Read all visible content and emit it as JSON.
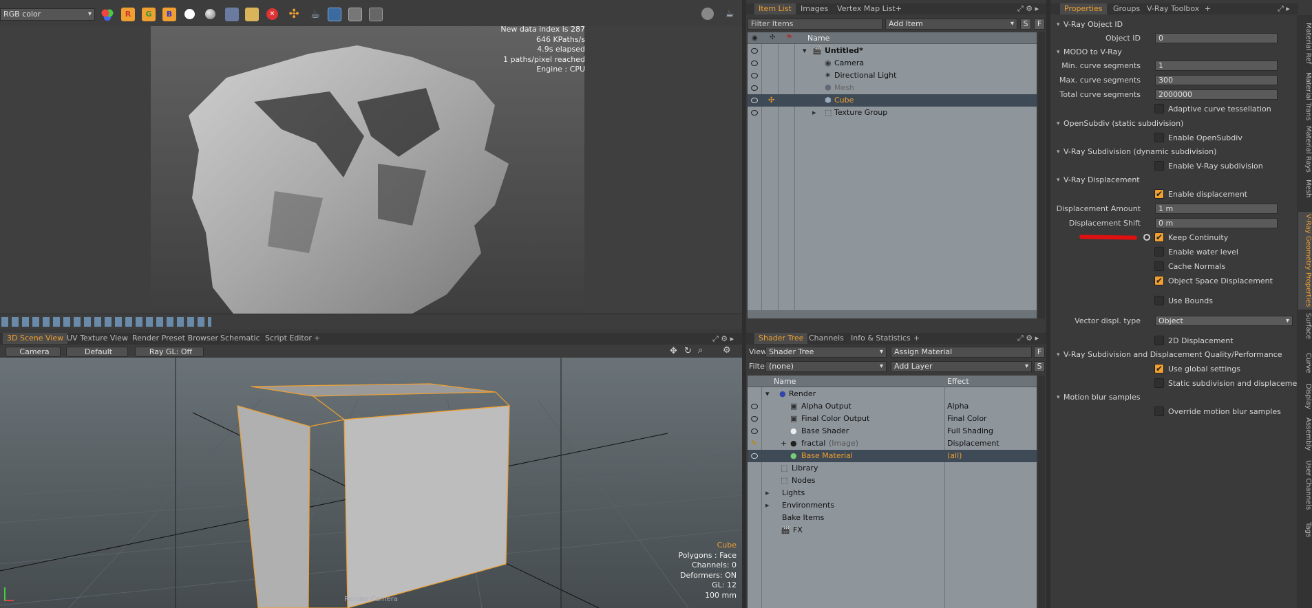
{
  "top_toolbar": {
    "color_mode": "RGB color",
    "channel_buttons": [
      "R",
      "G",
      "B"
    ]
  },
  "render_view": {
    "stats": [
      "New data index is 287",
      "646 KPaths/s",
      "4.9s elapsed",
      "1 paths/pixel reached",
      "Engine : CPU"
    ]
  },
  "scene_tabs": [
    "3D Scene View",
    "UV Texture View",
    "Render Preset Browser",
    "Schematic",
    "Script Editor",
    "+"
  ],
  "viewport_bar": {
    "camera": "Camera",
    "style": "Default",
    "raygl": "Ray GL: Off"
  },
  "viewport_info": {
    "item": "Cube",
    "lines": [
      "Polygons : Face",
      "Channels: 0",
      "Deformers: ON",
      "GL: 12",
      "100 mm"
    ],
    "render_camera": "Render Camera"
  },
  "item_list": {
    "tabs": [
      "Item List",
      "Images",
      "Vertex Map List",
      "+"
    ],
    "filter_placeholder": "Filter Items",
    "add_item": "Add Item",
    "sf": [
      "S",
      "F"
    ],
    "header_name": "Name",
    "items": [
      {
        "label": "Untitled*",
        "level": 0
      },
      {
        "label": "Camera",
        "level": 1
      },
      {
        "label": "Directional Light",
        "level": 1
      },
      {
        "label": "Mesh",
        "level": 1
      },
      {
        "label": "Cube",
        "level": 1
      },
      {
        "label": "Texture Group",
        "level": 1
      }
    ]
  },
  "shader_tree": {
    "tabs": [
      "Shader Tree",
      "Channels",
      "Info & Statistics",
      "+"
    ],
    "view_label": "View",
    "view_value": "Shader Tree",
    "assign": "Assign Material",
    "filter_label": "Filter",
    "filter_value": "(none)",
    "add_layer": "Add Layer",
    "header_name": "Name",
    "header_effect": "Effect",
    "rows": [
      {
        "name": "Render",
        "effect": ""
      },
      {
        "name": "Alpha Output",
        "effect": "Alpha"
      },
      {
        "name": "Final Color Output",
        "effect": "Final Color"
      },
      {
        "name": "Base Shader",
        "effect": "Full Shading"
      },
      {
        "name": "fractal",
        "sub": "(Image)",
        "effect": "Displacement"
      },
      {
        "name": "Base Material",
        "effect": "(all)"
      },
      {
        "name": "Library",
        "effect": ""
      },
      {
        "name": "Nodes",
        "effect": ""
      },
      {
        "name": "Lights",
        "effect": ""
      },
      {
        "name": "Environments",
        "effect": ""
      },
      {
        "name": "Bake Items",
        "effect": ""
      },
      {
        "name": "FX",
        "effect": ""
      }
    ]
  },
  "properties": {
    "tabs": [
      "Properties",
      "Groups",
      "V-Ray Toolbox",
      "+"
    ],
    "sections": {
      "object_id": "V-Ray Object ID",
      "modo": "MODO to V-Ray",
      "opensubdiv": "OpenSubdiv (static subdivision)",
      "vray_subdiv": "V-Ray Subdivision (dynamic subdivision)",
      "displacement": "V-Ray Displacement",
      "quality": "V-Ray Subdivision and Displacement Quality/Performance",
      "motion": "Motion blur samples"
    },
    "fields": {
      "object_id": {
        "label": "Object ID",
        "value": "0"
      },
      "min_curve": {
        "label": "Min. curve segments",
        "value": "1"
      },
      "max_curve": {
        "label": "Max. curve segments",
        "value": "300"
      },
      "total_curve": {
        "label": "Total curve segments",
        "value": "2000000"
      },
      "disp_amount": {
        "label": "Displacement Amount",
        "value": "1 m"
      },
      "disp_shift": {
        "label": "Displacement Shift",
        "value": "0 m"
      },
      "vector_type": {
        "label": "Vector displ. type",
        "value": "Object"
      }
    },
    "checks": {
      "adaptive": "Adaptive curve tessellation",
      "enable_opensubdiv": "Enable OpenSubdiv",
      "enable_vray_subdiv": "Enable V-Ray subdivision",
      "enable_disp": "Enable displacement",
      "keep_continuity": "Keep Continuity",
      "water_level": "Enable water level",
      "cache_normals": "Cache Normals",
      "object_space": "Object Space Displacement",
      "use_bounds": "Use Bounds",
      "disp2d": "2D Displacement",
      "global_settings": "Use global settings",
      "static_subdiv": "Static subdivision and displacement",
      "override_motion": "Override motion blur samples"
    },
    "side_tabs": [
      "Material Ref",
      "Material Trans",
      "Material Rays",
      "Mesh",
      "V-Ray Geometry Properties",
      "Surface",
      "Curve",
      "Display",
      "Assembly",
      "User Channels",
      "Tags"
    ]
  },
  "colors": {
    "accent": "#f0a030",
    "selected_row": "#3e4a56",
    "annotation": "#e01010"
  }
}
